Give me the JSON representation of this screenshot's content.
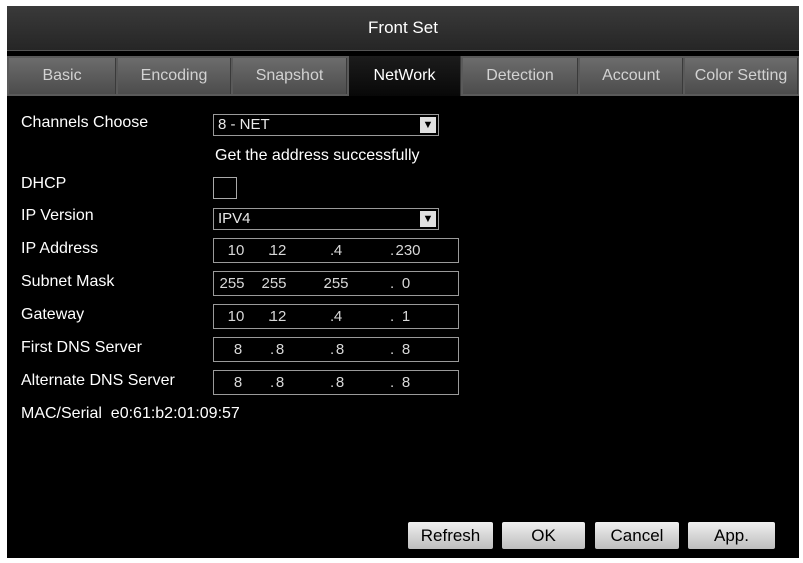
{
  "window": {
    "title": "Front Set"
  },
  "tabs": [
    {
      "label": "Basic"
    },
    {
      "label": "Encoding"
    },
    {
      "label": "Snapshot"
    },
    {
      "label": "NetWork"
    },
    {
      "label": "Detection"
    },
    {
      "label": "Account"
    },
    {
      "label": "Color Setting"
    }
  ],
  "active_tab": "NetWork",
  "form": {
    "channels_label": "Channels Choose",
    "channels_value": "8 - NET",
    "status_message": "Get the address successfully",
    "dhcp_label": "DHCP",
    "dhcp_checked": false,
    "ip_version_label": "IP Version",
    "ip_version_value": "IPV4",
    "ip_address_label": "IP Address",
    "ip_address": [
      "10",
      "12",
      "4",
      "230"
    ],
    "subnet_label": "Subnet Mask",
    "subnet": [
      "255",
      "255",
      "255",
      "0"
    ],
    "gateway_label": "Gateway",
    "gateway": [
      "10",
      "12",
      "4",
      "1"
    ],
    "dns1_label": "First DNS Server",
    "dns1": [
      "8",
      "8",
      "8",
      "8"
    ],
    "dns2_label": "Alternate DNS Server",
    "dns2": [
      "8",
      "8",
      "8",
      "8"
    ],
    "mac_label": "MAC/Serial",
    "mac_value": "e0:61:b2:01:09:57"
  },
  "buttons": {
    "refresh": "Refresh",
    "ok": "OK",
    "cancel": "Cancel",
    "apply": "App."
  },
  "colors": {
    "background": "#000000",
    "tab_inactive": "#5a5a5a",
    "button": "#d9d9d9"
  }
}
